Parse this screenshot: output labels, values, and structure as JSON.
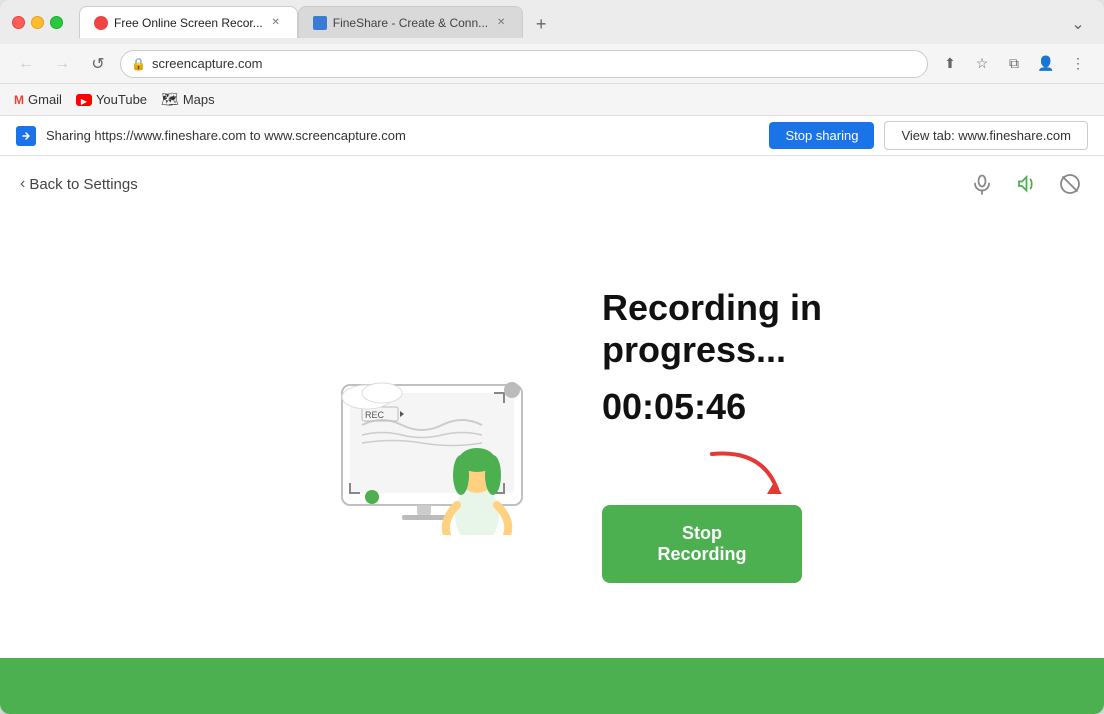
{
  "browser": {
    "tabs": [
      {
        "id": "tab1",
        "label": "Free Online Screen Recor...",
        "favicon_type": "record",
        "active": true
      },
      {
        "id": "tab2",
        "label": "FineShare - Create & Conn...",
        "favicon_type": "fineshare",
        "active": false
      }
    ],
    "address": "screencapture.com",
    "new_tab_label": "+",
    "expand_label": "⌄"
  },
  "nav": {
    "back_disabled": true,
    "forward_disabled": true
  },
  "bookmarks": [
    {
      "id": "gmail",
      "label": "Gmail",
      "icon": "gmail"
    },
    {
      "id": "youtube",
      "label": "YouTube",
      "icon": "youtube"
    },
    {
      "id": "maps",
      "label": "Maps",
      "icon": "maps"
    }
  ],
  "sharing_bar": {
    "text": "Sharing https://www.fineshare.com to www.screencapture.com",
    "stop_sharing_label": "Stop sharing",
    "view_tab_label": "View tab: www.fineshare.com"
  },
  "page": {
    "back_link_label": "Back to Settings",
    "icons": {
      "mic": "🎙",
      "sound": "🔊",
      "camera_off": "📷"
    }
  },
  "recording": {
    "title_line1": "Recording in",
    "title_line2": "progress...",
    "timer": "00:05:46",
    "stop_btn_label": "Stop Recording"
  }
}
